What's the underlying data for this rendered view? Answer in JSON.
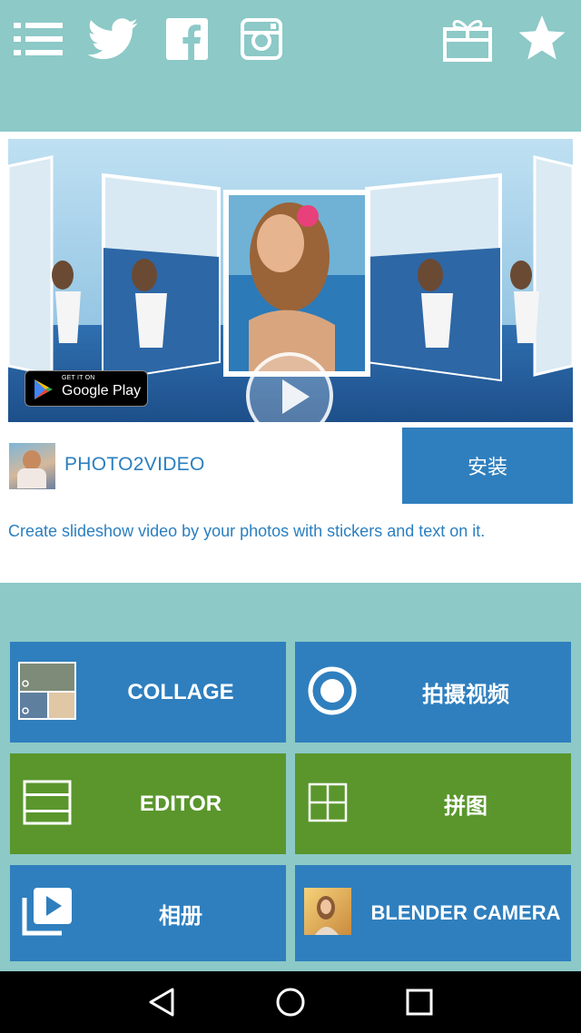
{
  "toolbar": {
    "icons": [
      "menu-icon",
      "twitter-icon",
      "facebook-icon",
      "instagram-icon",
      "gift-icon",
      "star-icon"
    ]
  },
  "ad": {
    "badge_small": "GET IT ON",
    "badge_big": "Google Play",
    "app_name": "PHOTO2VIDEO",
    "install_label": "安装",
    "description": "Create slideshow video by your photos with stickers and text on it."
  },
  "tiles": {
    "collage": "COLLAGE",
    "record_video": "拍摄视频",
    "editor": "EDITOR",
    "puzzle": "拼图",
    "album": "相册",
    "blender_camera": "BLENDER CAMERA"
  },
  "colors": {
    "background": "#8cc9c7",
    "tile_blue": "#2f7fbe",
    "tile_green": "#5a962c",
    "ad_text": "#2a7fc0"
  },
  "navbar": {
    "icons": [
      "back-icon",
      "home-icon",
      "recents-icon"
    ]
  }
}
